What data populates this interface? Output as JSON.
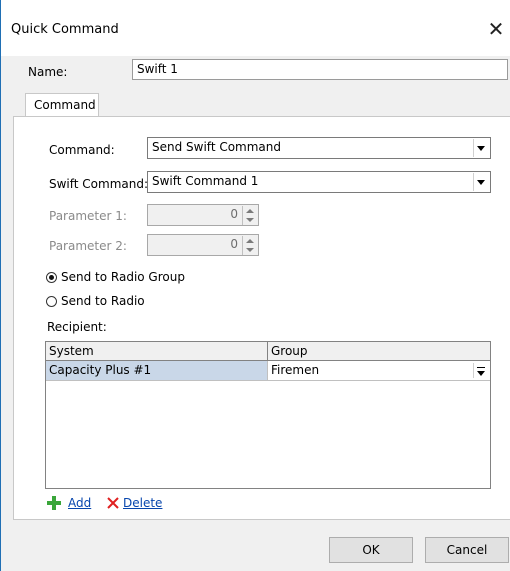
{
  "dialog": {
    "title": "Quick Command"
  },
  "name": {
    "label": "Name:",
    "value": "Swift 1"
  },
  "tab": {
    "label": "Command"
  },
  "command": {
    "label": "Command:",
    "value": "Send Swift Command"
  },
  "swift_command": {
    "label": "Swift Command:",
    "value": "Swift Command 1"
  },
  "parameter1": {
    "label": "Parameter 1:",
    "value": "0"
  },
  "parameter2": {
    "label": "Parameter 2:",
    "value": "0"
  },
  "send_to_radio_group": {
    "label": "Send to Radio Group",
    "checked": true
  },
  "send_to_radio": {
    "label": "Send to Radio",
    "checked": false
  },
  "recipient": {
    "label": "Recipient:",
    "columns": [
      "System",
      "Group"
    ],
    "rows": [
      {
        "system": "Capacity Plus #1",
        "group": "Firemen"
      }
    ]
  },
  "actions": {
    "add": "Add",
    "delete": "Delete"
  },
  "buttons": {
    "ok": "OK",
    "cancel": "Cancel"
  },
  "colors": {
    "selection": "#c9d7e8",
    "link": "#0645ad",
    "accent": "#1f6fb4"
  }
}
